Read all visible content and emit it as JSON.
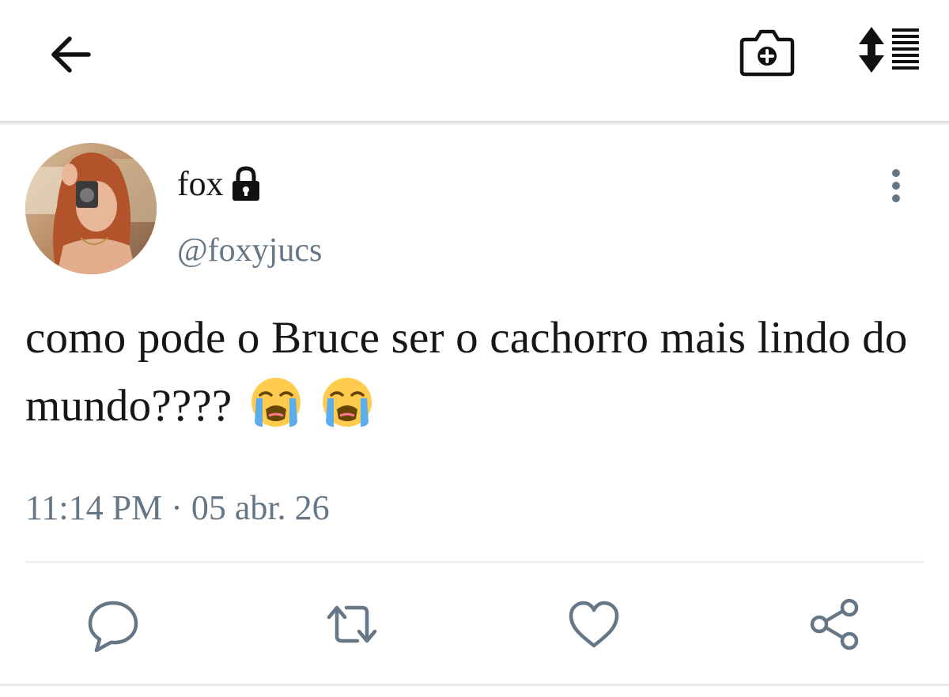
{
  "header": {
    "icons": {
      "back": "arrow-left-icon",
      "camera": "camera-plus-icon",
      "sort": "sort-list-icon"
    }
  },
  "tweet": {
    "display_name": "fox",
    "protected_icon": "lock-icon",
    "handle": "@foxyjucs",
    "text": "como pode o Bruce ser o cachorro mais lindo do mundo????",
    "emojis": [
      "loudly-crying-face",
      "loudly-crying-face"
    ],
    "timestamp": "11:14 PM · 05 abr. 26"
  },
  "actions": {
    "icons": [
      "reply-icon",
      "retweet-icon",
      "like-icon",
      "share-icon"
    ]
  },
  "colors": {
    "text": "#14171a",
    "secondary": "#657786",
    "divider": "#e6ecf0"
  }
}
